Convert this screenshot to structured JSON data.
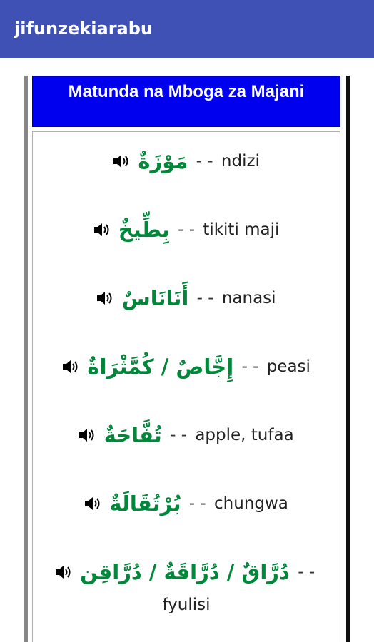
{
  "app": {
    "title": "jifunzekiarabu"
  },
  "header": {
    "title": "Matunda na Mboga za Majani"
  },
  "separator": "- -",
  "icons": {
    "speaker": "speaker-icon"
  },
  "colors": {
    "appbar": "#3f51b5",
    "header": "#0000ee",
    "arabic": "#00873a"
  },
  "items": [
    {
      "arabic": "مَوْزَةٌ",
      "meaning": "ndizi"
    },
    {
      "arabic": "بِطِّيخٌ",
      "meaning": "tikiti maji"
    },
    {
      "arabic": "أَنَانَاسٌ",
      "meaning": "nanasi"
    },
    {
      "arabic": "إِجَّاصٌ / كُمَّثْرَاةٌ",
      "meaning": "peasi"
    },
    {
      "arabic": "تُفَّاحَةٌ",
      "meaning": "apple, tufaa"
    },
    {
      "arabic": "بُرْتُقَالَةٌ",
      "meaning": "chungwa"
    },
    {
      "arabic": "دُرَّاقٌ / دُرَّاقَةٌ / دُرَّاقِن",
      "meaning": "fyulisi"
    }
  ]
}
